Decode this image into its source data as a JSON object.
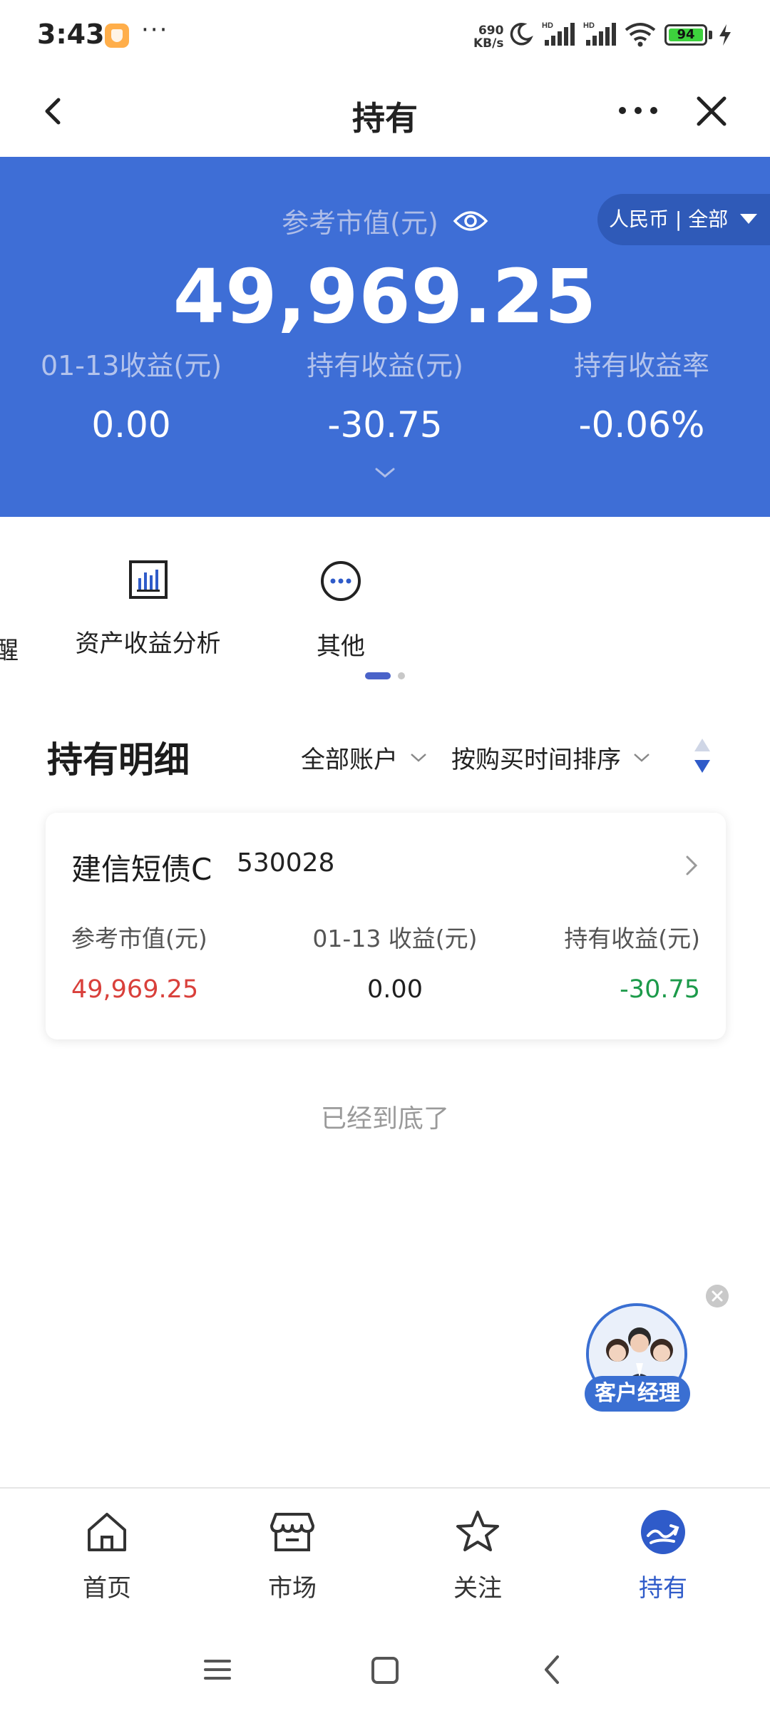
{
  "status_bar": {
    "time": "3:43",
    "more_dots": "···",
    "net_speed_value": "690",
    "net_speed_unit": "KB/s",
    "battery": "94"
  },
  "title_bar": {
    "title": "持有"
  },
  "summary": {
    "market_value_label": "参考市值(元)",
    "market_value": "49,969.25",
    "currency_filter": "人民币 | 全部",
    "daily_label": "01-13收益(元)",
    "daily_value": "0.00",
    "holding_label": "持有收益(元)",
    "holding_value": "-30.75",
    "rate_label": "持有收益率",
    "rate_value": "-0.06%"
  },
  "shortcuts": {
    "clipped_label": "醒",
    "items": [
      {
        "label": "资产收益分析",
        "icon": "bar-chart-icon"
      },
      {
        "label": "其他",
        "icon": "more-circle-icon"
      }
    ]
  },
  "holdings": {
    "title": "持有明细",
    "account_filter": "全部账户",
    "sort_filter": "按购买时间排序",
    "cards": [
      {
        "name": "建信短债C",
        "code": "530028",
        "market_value_label": "参考市值(元)",
        "market_value": "49,969.25",
        "daily_label": "01-13 收益(元)",
        "daily_value": "0.00",
        "holding_label": "持有收益(元)",
        "holding_value": "-30.75"
      }
    ],
    "end_note": "已经到底了"
  },
  "customer_manager": {
    "label": "客户经理"
  },
  "bottom_nav": {
    "items": [
      {
        "label": "首页",
        "icon": "home-icon"
      },
      {
        "label": "市场",
        "icon": "store-icon"
      },
      {
        "label": "关注",
        "icon": "star-icon"
      },
      {
        "label": "持有",
        "icon": "holding-icon",
        "active": true
      }
    ]
  },
  "colors": {
    "hero_blue": "#3e6ed6",
    "accent_blue": "#2f5bc9",
    "loss_green": "#1c9a4a",
    "value_red": "#d9403b"
  }
}
